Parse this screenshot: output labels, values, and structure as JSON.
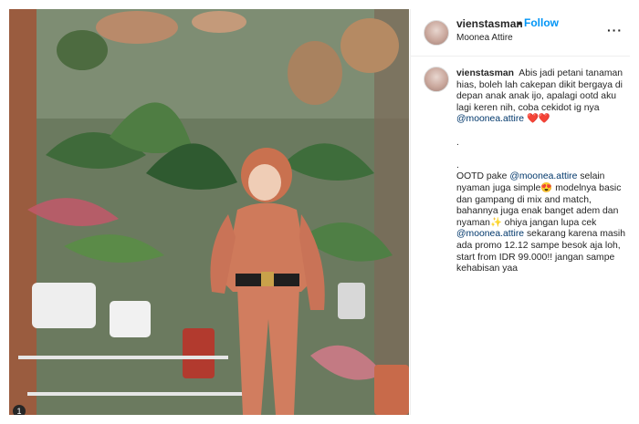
{
  "post": {
    "username": "vienstasman",
    "follow_label": "Follow",
    "separator": "•",
    "location": "Moonea Attire",
    "more_icon": "more-options-icon"
  },
  "caption": {
    "username": "vienstasman",
    "line1": "Abis jadi petani tanaman hias, boleh lah cakepan dikit bergaya di depan anak anak ijo, apalagi ootd aku lagi keren nih, coba cekidot ig nya",
    "mention1": "@moonea.attire",
    "hearts": "❤️❤️",
    "dot1": ".",
    "dot2": ".",
    "p2_a": "OOTD pake",
    "mention2": "@moonea.attire",
    "p2_b": "selain nyaman juga simple😍 modelnya basic dan gampang di mix and match, bahannya juga enak banget adem dan nyaman✨ ohiya jangan lupa cek",
    "mention3": "@moonea.attire",
    "p2_c": "sekarang karena masih ada promo 12.12 sampe besok aja loh, start from IDR 99.000!! jangan sampe kehabisan yaa"
  },
  "photo": {
    "description_icon": "post-photo",
    "carousel_indicator": "1"
  }
}
